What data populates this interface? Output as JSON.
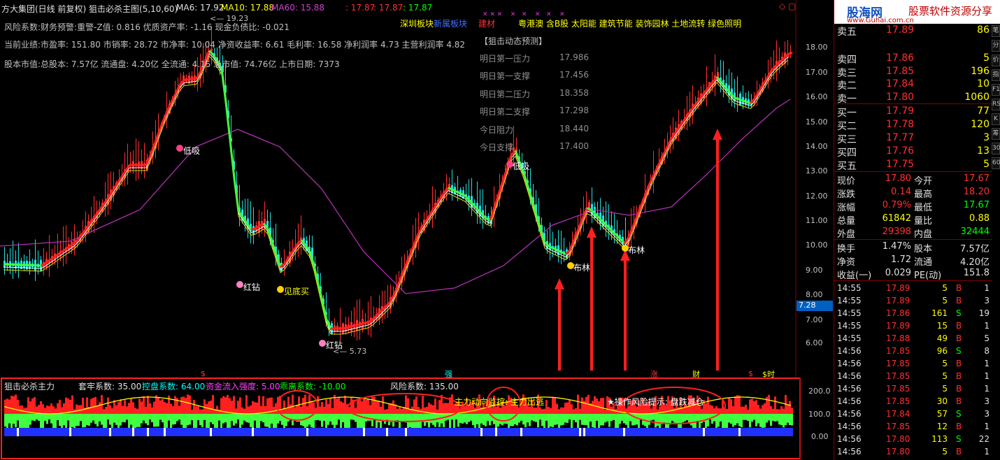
{
  "header": {
    "stock": "方大集团(日线 前复权)",
    "indicator": "狙击必杀主图(5,10,60)",
    "ma6": "MA6: 17.92",
    "ma10": "MA10: 17.88",
    "ma60": "MA60: 15.88",
    "extra1": ": 17.87",
    "extra2": ": 17.87",
    "extra3": ": 17.87"
  },
  "info": {
    "line1": "风险系数:财务预警:重警-Z值: 0.816 优质资产率: -1.16 现金负债比: -0.021",
    "line2": "当前业绩:市盈率: 151.80 市销率: 28.72 市净率: 10.04 净资收益率: 6.61 毛利率: 16.58 净利润率 4.73 主营利润率 4.82",
    "line3": "股本市值:总股本: 7.57亿 流通盘: 4.20亿 全流通: 4.15 总市值: 74.76亿 上市日期: 7373"
  },
  "sectors": {
    "a": "深圳板块",
    "b": "新属板块",
    "c": "建材",
    "d": "粤港澳 含B股 太阳能 建筑节能 装饰园林 土地流转 绿色照明"
  },
  "prediction": {
    "title": "【狙击动态预测】",
    "rows": [
      {
        "label": "明日第一压力",
        "value": "17.986"
      },
      {
        "label": "明日第一支撑",
        "value": "17.456"
      },
      {
        "label": "明日第二压力",
        "value": "18.358"
      },
      {
        "label": "明日第二支撑",
        "value": "17.298"
      },
      {
        "label": "今日阻力",
        "value": "18.440"
      },
      {
        "label": "今日支撑",
        "value": "17.400"
      }
    ]
  },
  "price_axis": [
    "18.00",
    "17.00",
    "16.00",
    "15.00",
    "14.00",
    "13.00",
    "12.00",
    "11.00",
    "10.00",
    "9.00",
    "8.00",
    "7.00",
    "6.00"
  ],
  "price_tag": "7.28",
  "annotations": {
    "high": "19.23",
    "low": "5.73",
    "dixi": "低吸",
    "hongzuan1": "红钻",
    "hongzuan2": "红钻",
    "kuaidabuy": "见底买",
    "buling1": "布林",
    "buling2": "布林",
    "dixi2": "低吸"
  },
  "bottom_markers": [
    "$",
    "强",
    "涨",
    "财",
    "$",
    "$时"
  ],
  "indicator": {
    "name": "狙击必杀主力",
    "p1": "套牢系数: 35.00",
    "p2": "控盘系数: 64.00",
    "p3": "资金流入强度: 5.00",
    "p4": "乖离系数: -10.00",
    "p5": "风险系数: 135.00",
    "monitor": "主力动向监控: 主力出逃",
    "risk": "★操作风险提示: 盘跌减仓",
    "axis": [
      "200.0",
      "100.0",
      "0.00"
    ]
  },
  "logo": {
    "brand": "股海网",
    "slogan": "股票软件资源分享",
    "url": "www.Guhai.com.cn"
  },
  "orderbook": {
    "sells": [
      {
        "label": "卖五",
        "price": "17.89",
        "vol": "86"
      },
      {
        "label": "卖四",
        "price": "17.86",
        "vol": "5"
      },
      {
        "label": "卖三",
        "price": "17.85",
        "vol": "196"
      },
      {
        "label": "卖二",
        "price": "17.84",
        "vol": "10"
      },
      {
        "label": "卖一",
        "price": "17.80",
        "vol": "1060"
      }
    ],
    "buys": [
      {
        "label": "买一",
        "price": "17.79",
        "vol": "77"
      },
      {
        "label": "买二",
        "price": "17.78",
        "vol": "120"
      },
      {
        "label": "买三",
        "price": "17.77",
        "vol": "3"
      },
      {
        "label": "买四",
        "price": "17.76",
        "vol": "13"
      },
      {
        "label": "买五",
        "price": "17.75",
        "vol": "5"
      }
    ]
  },
  "stats": [
    {
      "l1": "现价",
      "v1": "17.80",
      "l2": "今开",
      "v2": "17.67"
    },
    {
      "l1": "涨跌",
      "v1": "0.14",
      "l2": "最高",
      "v2": "18.20"
    },
    {
      "l1": "涨幅",
      "v1": "0.79%",
      "l2": "最低",
      "v2": "17.67"
    },
    {
      "l1": "总量",
      "v1": "61842",
      "l2": "量比",
      "v2": "0.88"
    },
    {
      "l1": "外盘",
      "v1": "29398",
      "l2": "内盘",
      "v2": "32444"
    },
    {
      "l1": "换手",
      "v1": "1.47%",
      "l2": "股本",
      "v2": "7.57亿"
    },
    {
      "l1": "净资",
      "v1": "1.72",
      "l2": "流通",
      "v2": "4.20亿"
    },
    {
      "l1": "收益(一)",
      "v1": "0.029",
      "l2": "PE(动)",
      "v2": "151.8"
    }
  ],
  "trades": [
    {
      "t": "14:55",
      "p": "17.89",
      "v": "5",
      "s": "B",
      "n": "1"
    },
    {
      "t": "14:55",
      "p": "17.89",
      "v": "5",
      "s": "B",
      "n": "3"
    },
    {
      "t": "14:55",
      "p": "17.86",
      "v": "161",
      "s": "S",
      "n": "19"
    },
    {
      "t": "14:55",
      "p": "17.89",
      "v": "15",
      "s": "B",
      "n": "1"
    },
    {
      "t": "14:55",
      "p": "17.88",
      "v": "49",
      "s": "B",
      "n": "5"
    },
    {
      "t": "14:56",
      "p": "17.85",
      "v": "96",
      "s": "S",
      "n": "8"
    },
    {
      "t": "14:56",
      "p": "17.85",
      "v": "5",
      "s": "B",
      "n": "1"
    },
    {
      "t": "14:56",
      "p": "17.85",
      "v": "5",
      "s": "B",
      "n": "1"
    },
    {
      "t": "14:56",
      "p": "17.85",
      "v": "5",
      "s": "B",
      "n": "1"
    },
    {
      "t": "14:56",
      "p": "17.85",
      "v": "30",
      "s": "B",
      "n": "3"
    },
    {
      "t": "14:56",
      "p": "17.84",
      "v": "57",
      "s": "S",
      "n": "3"
    },
    {
      "t": "14:56",
      "p": "17.85",
      "v": "12",
      "s": "B",
      "n": "1"
    },
    {
      "t": "14:56",
      "p": "17.80",
      "v": "113",
      "s": "S",
      "n": "22"
    },
    {
      "t": "14:56",
      "p": "17.80",
      "v": "5",
      "s": "B",
      "n": "1"
    }
  ],
  "sidebar": [
    "笔",
    "分",
    "价",
    "指",
    "F10",
    "RSI",
    "K",
    "筹",
    "30",
    "60"
  ]
}
